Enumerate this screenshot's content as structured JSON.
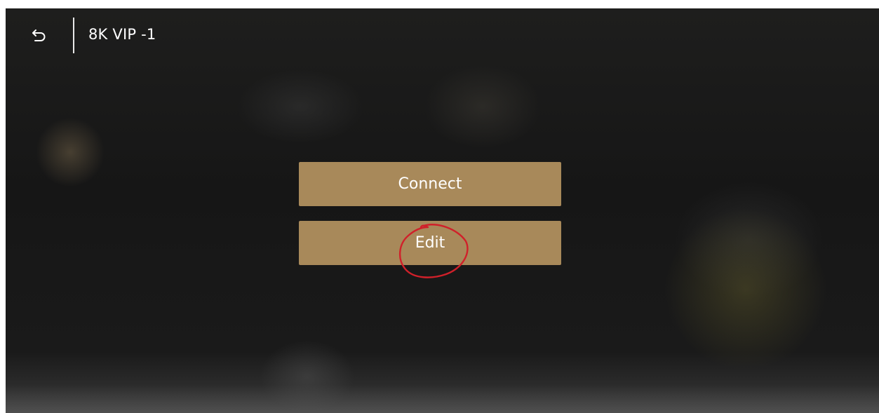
{
  "header": {
    "back_icon": "back-arrow-icon",
    "title": "8K VIP -1"
  },
  "actions": {
    "connect_label": "Connect",
    "edit_label": "Edit"
  },
  "colors": {
    "button_bg": "#a8895a",
    "annotation": "#d0202a",
    "text": "#ffffff"
  }
}
